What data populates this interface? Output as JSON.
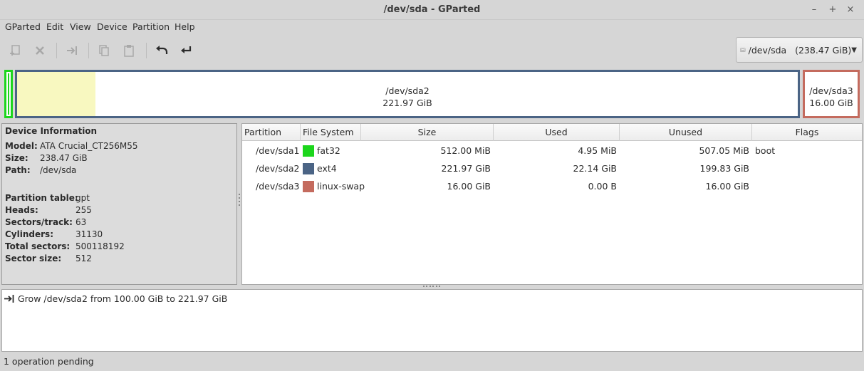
{
  "window": {
    "title": "/dev/sda - GParted"
  },
  "menu": [
    "GParted",
    "Edit",
    "View",
    "Device",
    "Partition",
    "Help"
  ],
  "toolbar": {
    "buttons": [
      "new-partition",
      "delete-partition",
      "resize-move",
      "copy",
      "paste",
      "undo",
      "apply"
    ]
  },
  "device_selector": {
    "label": "/dev/sda   (238.47 GiB)"
  },
  "disk_map": {
    "sda2": {
      "name": "/dev/sda2",
      "size": "221.97 GiB",
      "used_fraction": 0.1
    },
    "sda3": {
      "name": "/dev/sda3",
      "size": "16.00 GiB"
    }
  },
  "device_info": {
    "heading": "Device Information",
    "rows": [
      {
        "key": "Model:",
        "value": "ATA Crucial_CT256M55"
      },
      {
        "key": "Size:",
        "value": "238.47 GiB"
      },
      {
        "key": "Path:",
        "value": "/dev/sda"
      },
      {
        "key": "Partition table:",
        "value": "gpt"
      },
      {
        "key": "Heads:",
        "value": "255"
      },
      {
        "key": "Sectors/track:",
        "value": "63"
      },
      {
        "key": "Cylinders:",
        "value": "31130"
      },
      {
        "key": "Total sectors:",
        "value": "500118192"
      },
      {
        "key": "Sector size:",
        "value": "512"
      }
    ]
  },
  "table": {
    "columns": [
      "Partition",
      "File System",
      "Size",
      "Used",
      "Unused",
      "Flags"
    ],
    "rows": [
      {
        "partition": "/dev/sda1",
        "fs": "fat32",
        "fs_color": "#1cd61c",
        "size": "512.00 MiB",
        "used": "4.95 MiB",
        "unused": "507.05 MiB",
        "flags": "boot"
      },
      {
        "partition": "/dev/sda2",
        "fs": "ext4",
        "fs_color": "#4b6485",
        "size": "221.97 GiB",
        "used": "22.14 GiB",
        "unused": "199.83 GiB",
        "flags": ""
      },
      {
        "partition": "/dev/sda3",
        "fs": "linux-swap",
        "fs_color": "#c46b5e",
        "size": "16.00 GiB",
        "used": "0.00 B",
        "unused": "16.00 GiB",
        "flags": ""
      }
    ]
  },
  "operations": [
    {
      "icon": "resize-icon",
      "text": "Grow /dev/sda2 from 100.00 GiB to 221.97 GiB"
    }
  ],
  "status": {
    "text": "1 operation pending"
  }
}
